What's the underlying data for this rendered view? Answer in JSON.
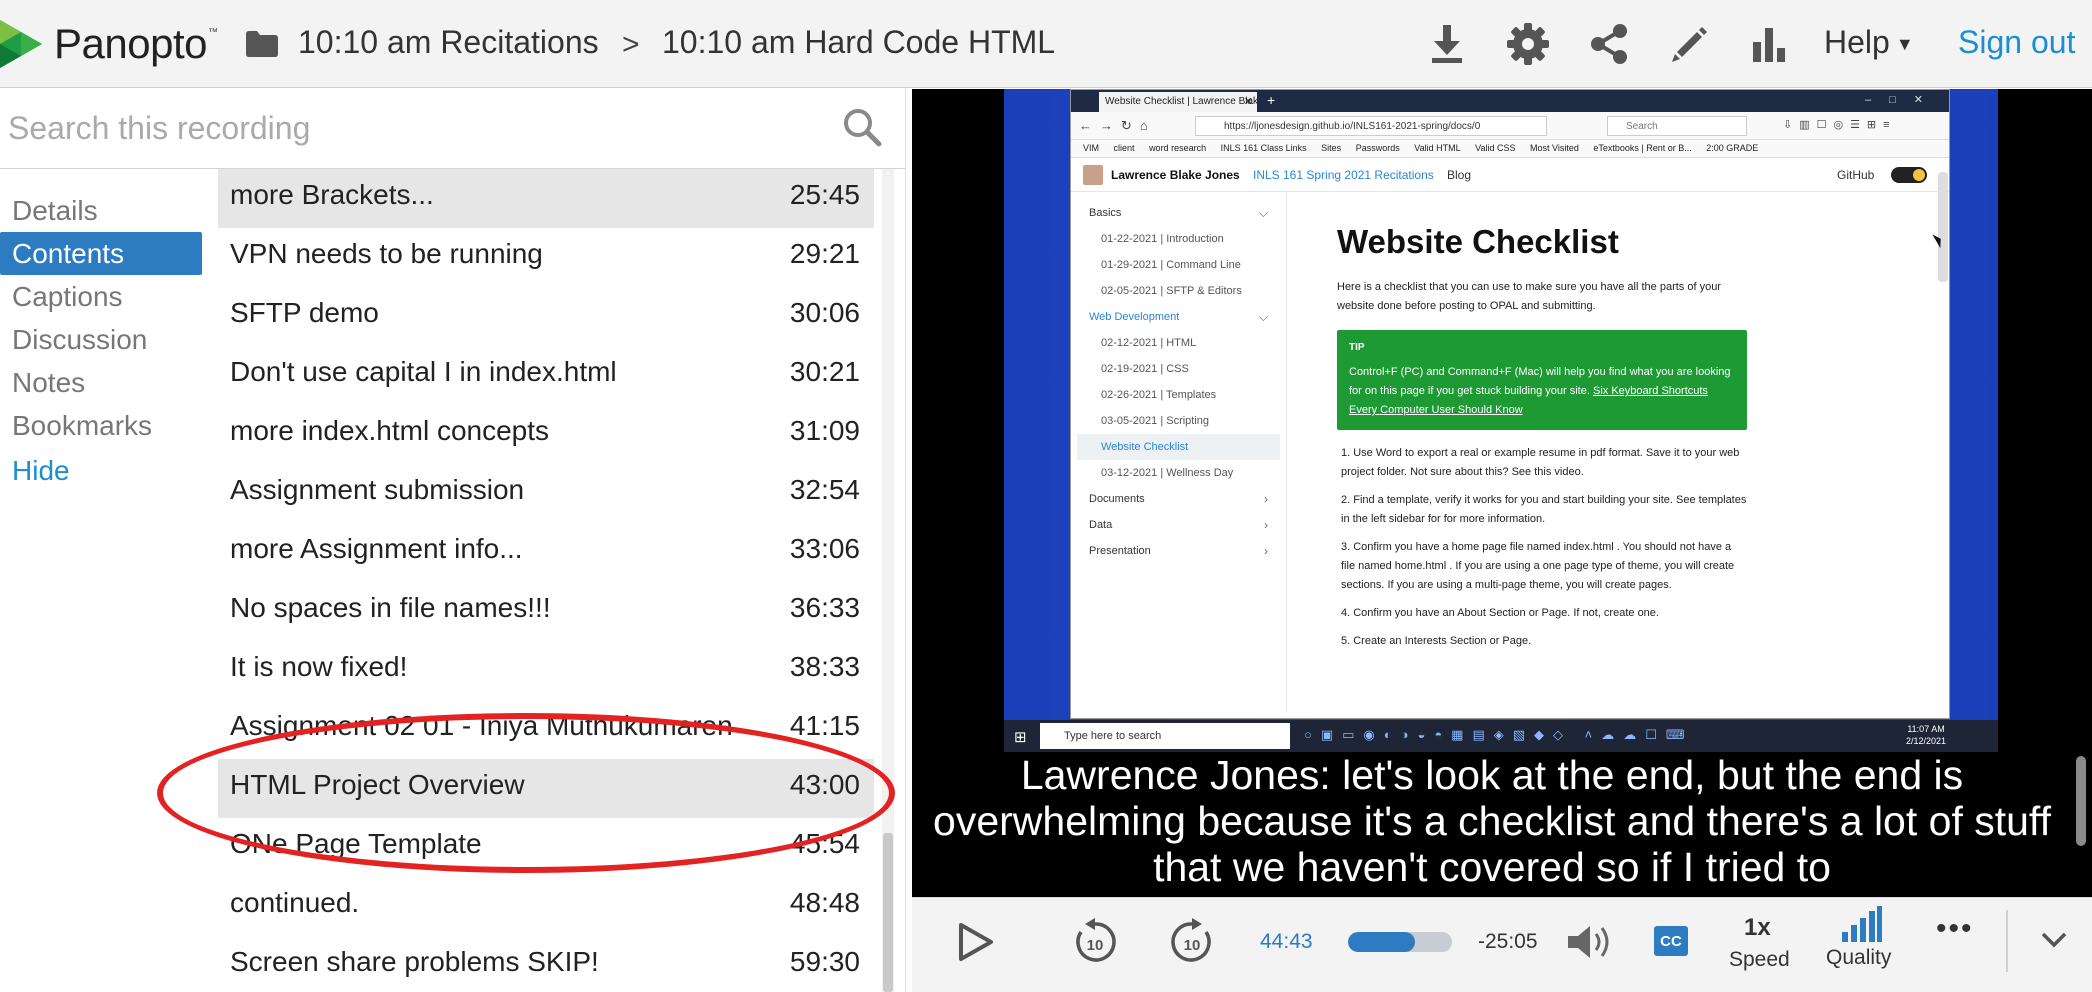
{
  "header": {
    "logo_text": "Panopto",
    "logo_tm": "™",
    "breadcrumb_folder": "10:10 am Recitations",
    "breadcrumb_separator": ">",
    "breadcrumb_session": "10:10 am Hard Code HTML",
    "help_label": "Help",
    "signout_label": "Sign out",
    "icons": [
      "download-icon",
      "gear-icon",
      "share-icon",
      "pencil-icon",
      "stats-icon"
    ]
  },
  "search": {
    "placeholder": "Search this recording"
  },
  "tabs": {
    "details": "Details",
    "contents": "Contents",
    "captions": "Captions",
    "discussion": "Discussion",
    "notes": "Notes",
    "bookmarks": "Bookmarks",
    "hide": "Hide",
    "active": "Contents"
  },
  "contents": [
    {
      "title": "more Brackets...",
      "time": "25:45"
    },
    {
      "title": "VPN needs to be running",
      "time": "29:21"
    },
    {
      "title": "SFTP demo",
      "time": "30:06"
    },
    {
      "title": "Don't use capital I in index.html",
      "time": "30:21"
    },
    {
      "title": "more index.html concepts",
      "time": "31:09"
    },
    {
      "title": "Assignment submission",
      "time": "32:54"
    },
    {
      "title": "more Assignment info...",
      "time": "33:06"
    },
    {
      "title": "No spaces in file names!!!",
      "time": "36:33"
    },
    {
      "title": "It is now fixed!",
      "time": "38:33"
    },
    {
      "title": "Assignment 02 01 - Iniya Muthukumaren",
      "time": "41:15"
    },
    {
      "title": "HTML Project Overview",
      "time": "43:00"
    },
    {
      "title": "ONe Page Template",
      "time": "45:54"
    },
    {
      "title": "continued.",
      "time": "48:48"
    },
    {
      "title": "Screen share problems SKIP!",
      "time": "59:30"
    }
  ],
  "video": {
    "browser": {
      "tab_title": "Website Checklist | Lawrence Blake",
      "url": "https://ljonesdesign.github.io/INLS161-2021-spring/docs/0",
      "search_placeholder": "Search",
      "bookmarks": [
        "VIM",
        "client",
        "word research",
        "INLS 161 Class Links",
        "Sites",
        "Passwords",
        "Valid HTML",
        "Valid CSS",
        "Most Visited",
        "eTextbooks | Rent or B...",
        "2:00 GRADE"
      ]
    },
    "site": {
      "name": "Lawrence Blake Jones",
      "nav_link_1": "INLS 161 Spring 2021 Recitations",
      "nav_link_2": "Blog",
      "github": "GitHub",
      "sidebar": [
        {
          "label": "Basics",
          "kind": "group"
        },
        {
          "label": "01-22-2021 | Introduction",
          "kind": "sub"
        },
        {
          "label": "01-29-2021 | Command Line",
          "kind": "sub"
        },
        {
          "label": "02-05-2021 | SFTP & Editors",
          "kind": "sub"
        },
        {
          "label": "Web Development",
          "kind": "group-blue"
        },
        {
          "label": "02-12-2021 | HTML",
          "kind": "sub"
        },
        {
          "label": "02-19-2021 | CSS",
          "kind": "sub"
        },
        {
          "label": "02-26-2021 | Templates",
          "kind": "sub"
        },
        {
          "label": "03-05-2021 | Scripting",
          "kind": "sub"
        },
        {
          "label": "Website Checklist",
          "kind": "current"
        },
        {
          "label": "03-12-2021 | Wellness Day",
          "kind": "sub"
        },
        {
          "label": "Documents",
          "kind": "group-right"
        },
        {
          "label": "Data",
          "kind": "group-right"
        },
        {
          "label": "Presentation",
          "kind": "group-right"
        }
      ],
      "page_title": "Website Checklist",
      "intro": "Here is a checklist that you can use to make sure you have all the parts of your website done before posting to OPAL and submitting.",
      "tip_heading": "TIP",
      "tip_text": "Control+F (PC) and Command+F (Mac) will help you find what you are looking for on this page if you get stuck building your site.",
      "tip_link": "Six Keyboard Shortcuts Every Computer User Should Know",
      "items": [
        "1. Use Word to export a real or example resume in pdf format. Save it to your web project folder. Not sure about this? See this video.",
        "2. Find a template, verify it works for you and start building your site. See templates in the left sidebar for for more information.",
        "3. Confirm you have a home page file named index.html . You should not have a file named home.html . If you are using a one page type of theme, you will create sections. If you are using a multi-page theme, you will create pages.",
        "4. Confirm you have an About Section or Page. If not, create one.",
        "5. Create an Interests Section or Page."
      ]
    },
    "taskbar": {
      "search_placeholder": "Type here to search",
      "time": "11:07 AM",
      "date": "2/12/2021"
    },
    "caption": "Lawrence Jones: let's look at the end, but the end is overwhelming because it's a checklist and there's a lot of stuff that we haven't covered so if I tried to"
  },
  "controls": {
    "current_time": "44:43",
    "remaining_time": "-25:05",
    "progress_fraction": 0.64,
    "cc_label": "CC",
    "speed_value": "1x",
    "speed_label": "Speed",
    "quality_label": "Quality",
    "more_label": "•••",
    "rewind_label": "10",
    "forward_label": "10"
  },
  "colors": {
    "accent": "#2d7cc2",
    "link": "#1a8fd1",
    "annotation": "#e32222"
  }
}
